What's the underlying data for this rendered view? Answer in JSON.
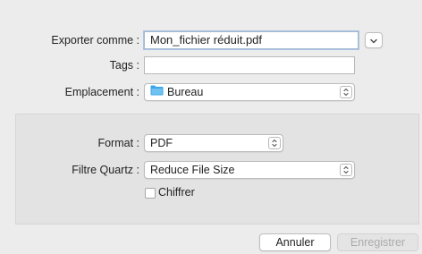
{
  "save_dialog": {
    "export_as_label": "Exporter comme :",
    "export_as_value": "Mon_fichier réduit.pdf",
    "tags_label": "Tags :",
    "tags_value": "",
    "location_label": "Emplacement :",
    "location_value": "Bureau",
    "location_icon": "folder-icon"
  },
  "options_panel": {
    "format_label": "Format :",
    "format_value": "PDF",
    "quartz_filter_label": "Filtre Quartz :",
    "quartz_filter_value": "Reduce File Size",
    "encrypt_label": "Chiffrer",
    "encrypt_checked": false
  },
  "buttons": {
    "cancel_label": "Annuler",
    "save_label": "Enregistrer"
  },
  "colors": {
    "folder_blue": "#3ea6e8",
    "disabled_text": "#ababab"
  }
}
